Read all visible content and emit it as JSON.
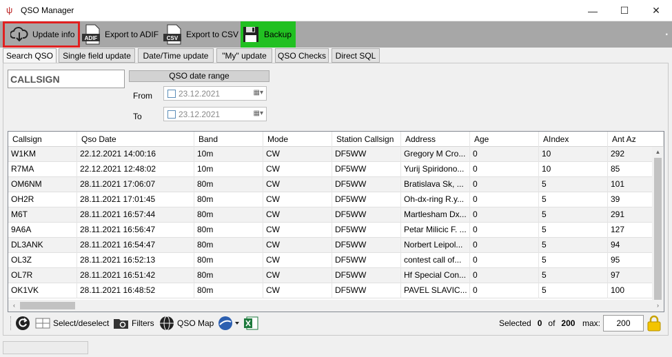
{
  "window": {
    "title": "QSO Manager",
    "minimize": "—",
    "maximize": "☐",
    "close": "✕"
  },
  "toolbar": {
    "update_label": "Update info",
    "adif_label": "Export to ADIF",
    "csv_label": "Export to CSV",
    "backup_label": "Backup",
    "adif_icon_text": "ADIF",
    "csv_icon_text": "CSV"
  },
  "tabs": [
    "Search QSO",
    "Single field update",
    "Date/Time update",
    "\"My\" update",
    "QSO Checks",
    "Direct SQL"
  ],
  "search": {
    "callsign_value": "CALLSIGN",
    "date_range_label": "QSO date range",
    "from_label": "From",
    "to_label": "To",
    "from_value": "23.12.2021",
    "to_value": "23.12.2021"
  },
  "grid": {
    "columns": [
      "Callsign",
      "Qso Date",
      "Band",
      "Mode",
      "Station Callsign",
      "Address",
      "Age",
      "AIndex",
      "Ant Az"
    ],
    "rows": [
      [
        "W1KM",
        "22.12.2021 14:00:16",
        "10m",
        "CW",
        "DF5WW",
        "Gregory M Cro...",
        "0",
        "10",
        "292"
      ],
      [
        "R7MA",
        "22.12.2021 12:48:02",
        "10m",
        "CW",
        "DF5WW",
        "Yurij Spiridono...",
        "0",
        "10",
        "85"
      ],
      [
        "OM6NM",
        "28.11.2021 17:06:07",
        "80m",
        "CW",
        "DF5WW",
        "Bratislava Sk, ...",
        "0",
        "5",
        "101"
      ],
      [
        "OH2R",
        "28.11.2021 17:01:45",
        "80m",
        "CW",
        "DF5WW",
        "Oh-dx-ring R.y...",
        "0",
        "5",
        "39"
      ],
      [
        "M6T",
        "28.11.2021 16:57:44",
        "80m",
        "CW",
        "DF5WW",
        "Martlesham Dx...",
        "0",
        "5",
        "291"
      ],
      [
        "9A6A",
        "28.11.2021 16:56:47",
        "80m",
        "CW",
        "DF5WW",
        "Petar Milicic F. ...",
        "0",
        "5",
        "127"
      ],
      [
        "DL3ANK",
        "28.11.2021 16:54:47",
        "80m",
        "CW",
        "DF5WW",
        "Norbert Leipol...",
        "0",
        "5",
        "94"
      ],
      [
        "OL3Z",
        "28.11.2021 16:52:13",
        "80m",
        "CW",
        "DF5WW",
        "contest call of...",
        "0",
        "5",
        "95"
      ],
      [
        "OL7R",
        "28.11.2021 16:51:42",
        "80m",
        "CW",
        "DF5WW",
        "Hf Special Con...",
        "0",
        "5",
        "97"
      ],
      [
        "OK1VK",
        "28.11.2021 16:48:52",
        "80m",
        "CW",
        "DF5WW",
        "PAVEL SLAVIC...",
        "0",
        "5",
        "100"
      ]
    ]
  },
  "bottom": {
    "select_label": "Select/deselect",
    "filters_label": "Filters",
    "qso_map_label": "QSO Map",
    "selected_label": "Selected",
    "selected_count": "0",
    "of_label": "of",
    "total_count": "200",
    "max_label": "max:",
    "max_value": "200"
  }
}
